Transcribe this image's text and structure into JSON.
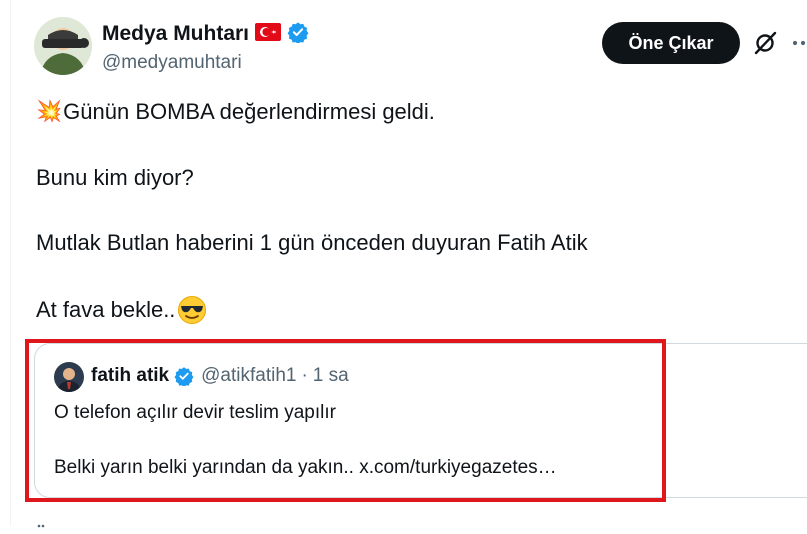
{
  "author": {
    "display_name": "Medya Muhtarı",
    "handle": "@medyamuhtari",
    "flag_icon": "turkey-flag-icon",
    "verified_icon": "verified-badge-icon"
  },
  "actions": {
    "follow_label": "Öne Çıkar",
    "grok_icon": "grok-icon",
    "more_icon": "more-icon"
  },
  "tweet": {
    "line1_emoji": "💥",
    "line1": "Günün BOMBA değerlendirmesi geldi.",
    "line2": "Bunu kim diyor?",
    "line3": "Mutlak Butlan haberini 1 gün önceden duyuran Fatih Atik",
    "line4": "At fava bekle..",
    "line4_emoji": "😎"
  },
  "quote": {
    "display_name": "fatih atik",
    "handle": "@atikfatih1",
    "separator": "·",
    "time": "1 sa",
    "line1": "O telefon açılır devir teslim yapılır",
    "line2": "Belki yarın belki yarından da yakın.. x.com/turkiyegazetes…"
  },
  "colors": {
    "text": "#0f1419",
    "muted": "#536471",
    "verified": "#1d9bf0",
    "highlight": "#e0161d",
    "border": "#cfd9de"
  }
}
